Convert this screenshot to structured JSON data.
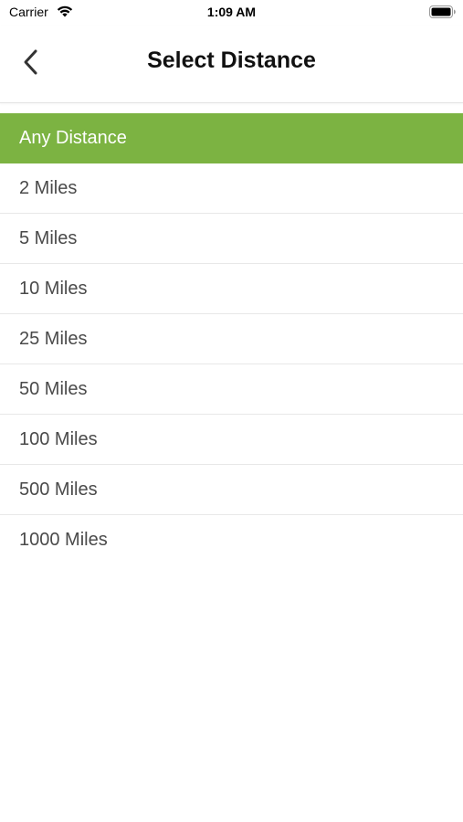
{
  "status_bar": {
    "carrier": "Carrier",
    "time": "1:09 AM",
    "wifi_icon": "wifi-icon",
    "battery_icon": "battery-icon"
  },
  "header": {
    "title": "Select Distance",
    "back_icon": "chevron-left-icon"
  },
  "distance_list": {
    "selected_index": 0,
    "accent_color": "#7cb342",
    "items": [
      {
        "label": "Any Distance"
      },
      {
        "label": "2 Miles"
      },
      {
        "label": "5 Miles"
      },
      {
        "label": "10 Miles"
      },
      {
        "label": "25 Miles"
      },
      {
        "label": "50 Miles"
      },
      {
        "label": "100 Miles"
      },
      {
        "label": "500 Miles"
      },
      {
        "label": "1000 Miles"
      }
    ]
  }
}
